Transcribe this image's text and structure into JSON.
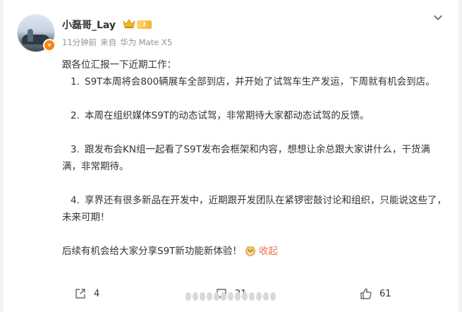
{
  "post": {
    "username": "小磊哥_Lay",
    "level_badge": "1",
    "time": "11分钟前",
    "source_prefix": "来自",
    "source_device": "华为 Mate X5",
    "intro": "跟各位汇报一下近期工作：",
    "items": [
      {
        "num": "1.",
        "text": "S9T本周将会800辆展车全部到店，并开始了试驾车生产发运，下周就有机会到店。"
      },
      {
        "num": "2.",
        "text": "本周在组织媒体S9T的动态试驾，非常期待大家都动态试驾的反馈。"
      },
      {
        "num": "3.",
        "text": "跟发布会KN组一起看了S9T发布会框架和内容，想想让余总跟大家讲什么，干货满满，非常期待。"
      },
      {
        "num": "4.",
        "text": "享界还有很多新品在开发中，近期跟开发团队在紧锣密鼓讨论和组织，只能说这些了，未来可期！"
      }
    ],
    "closing": "后续有机会给大家分享S9T新功能新体验！",
    "collapse_label": "收起",
    "verified_icon": "v-verified-icon",
    "accent_color": "#eb7350"
  },
  "actions": {
    "share_count": "4",
    "comment_count": "21",
    "like_count": "61"
  }
}
